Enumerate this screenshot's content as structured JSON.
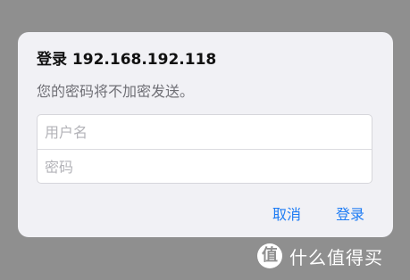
{
  "dialog": {
    "title": "登录 192.168.192.118",
    "subtitle": "您的密码将不加密发送。",
    "username_placeholder": "用户名",
    "username_value": "",
    "password_placeholder": "密码",
    "password_value": "",
    "cancel_label": "取消",
    "login_label": "登录"
  },
  "watermark": {
    "badge": "值",
    "text": "什么值得买"
  },
  "colors": {
    "backdrop": "#8f8f8f",
    "dialog_bg": "#f1f1f5",
    "accent": "#1e7cf4"
  }
}
